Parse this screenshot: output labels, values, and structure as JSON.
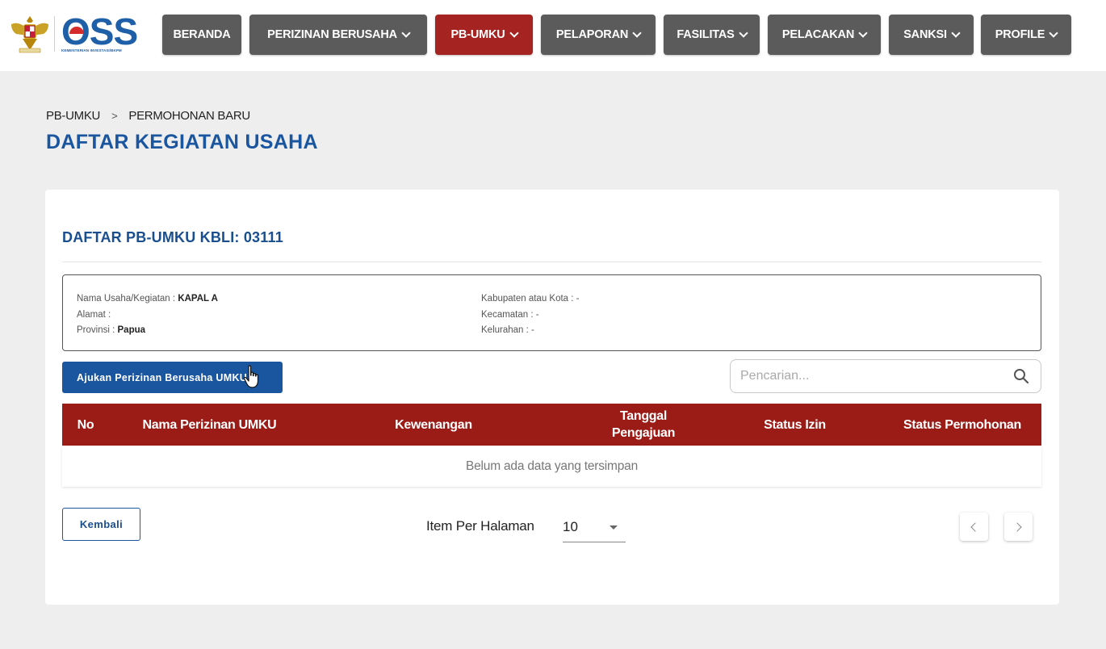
{
  "header": {
    "logo_text": "OSS",
    "logo_subtitle": "KEMENTERIAN INVESTASI/BKPM",
    "nav": [
      {
        "label": "BERANDA",
        "dropdown": false,
        "active": false
      },
      {
        "label": "PERIZINAN BERUSAHA",
        "dropdown": true,
        "active": false
      },
      {
        "label": "PB-UMKU",
        "dropdown": true,
        "active": true
      },
      {
        "label": "PELAPORAN",
        "dropdown": true,
        "active": false
      },
      {
        "label": "FASILITAS",
        "dropdown": true,
        "active": false
      },
      {
        "label": "PELACAKAN",
        "dropdown": true,
        "active": false
      },
      {
        "label": "SANKSI",
        "dropdown": true,
        "active": false
      },
      {
        "label": "PROFILE",
        "dropdown": true,
        "active": false
      }
    ]
  },
  "breadcrumb": {
    "items": [
      "PB-UMKU",
      "PERMOHONAN BARU"
    ],
    "separator": ">"
  },
  "page_title": "DAFTAR KEGIATAN USAHA",
  "card": {
    "title": "DAFTAR PB-UMKU KBLI: 03111",
    "info": {
      "left": [
        {
          "label": "Nama Usaha/Kegiatan :",
          "value": "KAPAL A"
        },
        {
          "label": "Alamat :",
          "value": ""
        },
        {
          "label": "Provinsi :",
          "value": "Papua"
        }
      ],
      "right": [
        {
          "label": "Kabupaten atau Kota :",
          "value": "-"
        },
        {
          "label": "Kecamatan :",
          "value": "-"
        },
        {
          "label": "Kelurahan :",
          "value": "-"
        }
      ]
    },
    "submit_button": "Ajukan Perizinan Berusaha UMKU",
    "search": {
      "placeholder": "Pencarian...",
      "value": ""
    },
    "table": {
      "columns": [
        "No",
        "Nama Perizinan UMKU",
        "Kewenangan",
        "Tanggal Pengajuan",
        "Status Izin",
        "Status Permohonan"
      ],
      "empty_message": "Belum ada data yang tersimpan",
      "rows": []
    },
    "back_button": "Kembali",
    "pagination": {
      "per_page_label": "Item Per Halaman",
      "per_page_value": "10"
    }
  },
  "colors": {
    "nav_default": "#5b5b5b",
    "nav_active": "#a52320",
    "primary_blue": "#1a56a0",
    "table_header": "#9b1c17"
  }
}
